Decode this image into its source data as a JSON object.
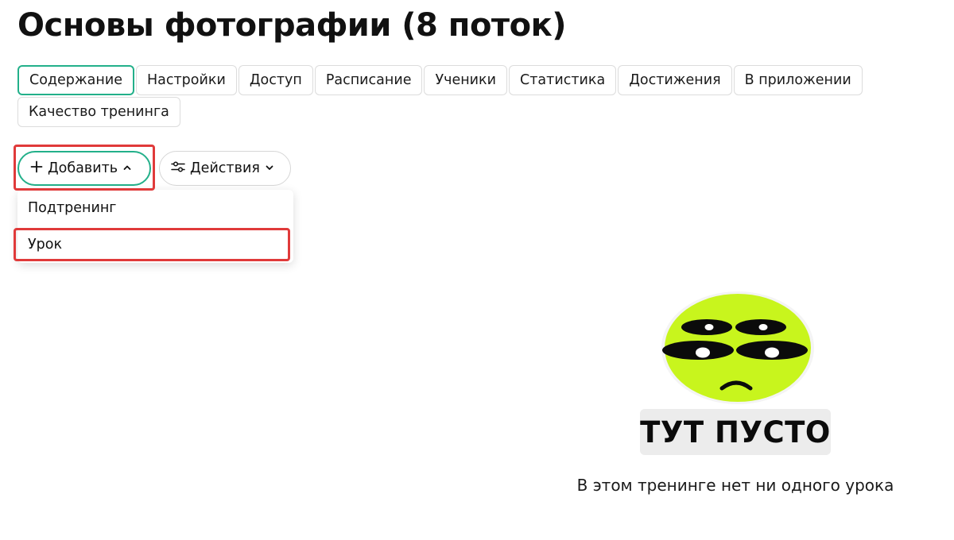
{
  "page": {
    "title": "Основы фотографии (8 поток)"
  },
  "tabs": [
    {
      "label": "Содержание",
      "active": true
    },
    {
      "label": "Настройки"
    },
    {
      "label": "Доступ"
    },
    {
      "label": "Расписание"
    },
    {
      "label": "Ученики"
    },
    {
      "label": "Статистика"
    },
    {
      "label": "Достижения"
    },
    {
      "label": "В приложении"
    },
    {
      "label": "Качество тренинга"
    }
  ],
  "toolbar": {
    "add_label": "Добавить",
    "actions_label": "Действия"
  },
  "add_menu": {
    "items": [
      {
        "label": "Подтренинг"
      },
      {
        "label": "Урок"
      }
    ]
  },
  "empty_state": {
    "badge": "ТУТ ПУСТО",
    "description": "В этом тренинге нет ни одного урока"
  },
  "colors": {
    "accent": "#23b08a",
    "highlight": "#e03a3a",
    "alien_face": "#c8f51d"
  },
  "icons": {
    "add": "plus-icon",
    "add_caret": "chevron-up-icon",
    "actions": "sliders-icon",
    "actions_caret": "chevron-down-icon"
  }
}
